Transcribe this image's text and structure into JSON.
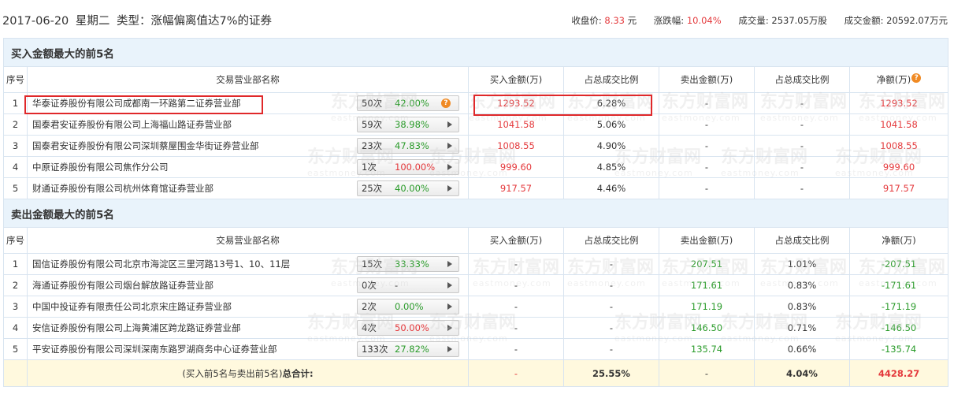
{
  "header": {
    "date": "2017-06-20",
    "weekday": "星期二",
    "type_label": "类型：涨幅偏离值达7%的证券",
    "close_label": "收盘价:",
    "close_value": "8.33",
    "close_unit": "元",
    "change_label": "涨跌幅:",
    "change_value": "10.04%",
    "volume_label": "成交量:",
    "volume_value": "2537.05万股",
    "turnover_label": "成交金额:",
    "turnover_value": "20592.07万元"
  },
  "columns": {
    "seq": "序号",
    "broker": "交易营业部名称",
    "buy_amount": "买入金额(万)",
    "buy_ratio": "占总成交比例",
    "sell_amount": "卖出金额(万)",
    "sell_ratio": "占总成交比例",
    "net": "净额(万)"
  },
  "buy_section": {
    "title": "买入金额最大的前5名",
    "rows": [
      {
        "seq": "1",
        "name": "华泰证券股份有限公司成都南一环路第二证券营业部",
        "times": "50次",
        "rate": "42.00%",
        "buy": "1293.52",
        "buy_ratio": "6.28%",
        "sell": "-",
        "sell_ratio": "-",
        "net": "1293.52"
      },
      {
        "seq": "2",
        "name": "国泰君安证券股份有限公司上海福山路证券营业部",
        "times": "59次",
        "rate": "38.98%",
        "buy": "1041.58",
        "buy_ratio": "5.06%",
        "sell": "-",
        "sell_ratio": "-",
        "net": "1041.58"
      },
      {
        "seq": "3",
        "name": "国泰君安证券股份有限公司深圳蔡屋围金华街证券营业部",
        "times": "23次",
        "rate": "47.83%",
        "buy": "1008.55",
        "buy_ratio": "4.90%",
        "sell": "-",
        "sell_ratio": "-",
        "net": "1008.55"
      },
      {
        "seq": "4",
        "name": "中原证券股份有限公司焦作分公司",
        "times": "1次",
        "rate": "100.00%",
        "buy": "999.60",
        "buy_ratio": "4.85%",
        "sell": "-",
        "sell_ratio": "-",
        "net": "999.60"
      },
      {
        "seq": "5",
        "name": "财通证券股份有限公司杭州体育馆证券营业部",
        "times": "25次",
        "rate": "40.00%",
        "buy": "917.57",
        "buy_ratio": "4.46%",
        "sell": "-",
        "sell_ratio": "-",
        "net": "917.57"
      }
    ]
  },
  "sell_section": {
    "title": "卖出金额最大的前5名",
    "rows": [
      {
        "seq": "1",
        "name": "国信证券股份有限公司北京市海淀区三里河路13号1、10、11层",
        "times": "15次",
        "rate": "33.33%",
        "buy": "-",
        "buy_ratio": "-",
        "sell": "207.51",
        "sell_ratio": "1.01%",
        "net": "-207.51"
      },
      {
        "seq": "2",
        "name": "海通证券股份有限公司烟台解放路证券营业部",
        "times": "0次",
        "rate": "-",
        "buy": "-",
        "buy_ratio": "-",
        "sell": "171.61",
        "sell_ratio": "0.83%",
        "net": "-171.61"
      },
      {
        "seq": "3",
        "name": "中国中投证券有限责任公司北京宋庄路证券营业部",
        "times": "2次",
        "rate": "0.00%",
        "buy": "-",
        "buy_ratio": "-",
        "sell": "171.19",
        "sell_ratio": "0.83%",
        "net": "-171.19"
      },
      {
        "seq": "4",
        "name": "安信证券股份有限公司上海黄浦区跨龙路证券营业部",
        "times": "4次",
        "rate": "50.00%",
        "buy": "-",
        "buy_ratio": "-",
        "sell": "146.50",
        "sell_ratio": "0.71%",
        "net": "-146.50"
      },
      {
        "seq": "5",
        "name": "平安证券股份有限公司深圳深南东路罗湖商务中心证券营业部",
        "times": "133次",
        "rate": "27.82%",
        "buy": "-",
        "buy_ratio": "-",
        "sell": "135.74",
        "sell_ratio": "0.66%",
        "net": "-135.74"
      }
    ]
  },
  "total": {
    "label_prefix": "(买入前5名与卖出前5名)",
    "label_bold": "总合计:",
    "buy": "-",
    "buy_ratio": "25.55%",
    "sell": "-",
    "sell_ratio": "4.04%",
    "net": "4428.27"
  },
  "watermark": {
    "cn": "东方财富网",
    "en": "eastmoney.com"
  },
  "colors": {
    "up": "#e4393c",
    "down": "#2a9b2a",
    "section_bg": "#e9f3fb",
    "total_bg": "#fff9de",
    "highlight": "#e0282a",
    "badge": "#f08a24"
  }
}
